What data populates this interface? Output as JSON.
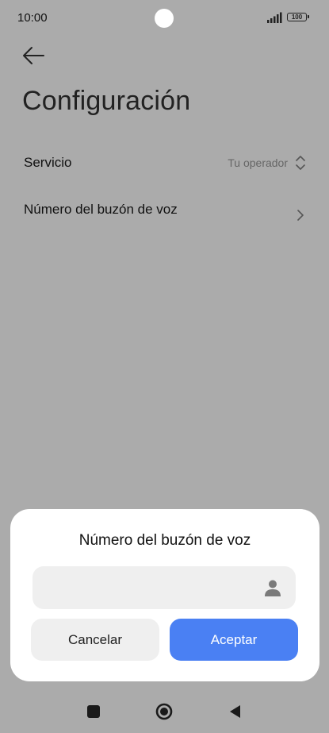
{
  "status_bar": {
    "time": "10:00",
    "battery": "100",
    "icons": [
      "signal-icon",
      "battery-icon"
    ]
  },
  "header": {
    "back_icon": "arrow-left-icon",
    "title": "Configuración"
  },
  "settings": {
    "service": {
      "label": "Servicio",
      "value": "Tu operador",
      "icon": "chevron-up-down-icon"
    },
    "voicemail_number": {
      "label": "Número del buzón de voz",
      "icon": "chevron-right-icon"
    }
  },
  "dialog": {
    "title": "Número del buzón de voz",
    "input_value": "",
    "input_icon": "contact-icon",
    "cancel_label": "Cancelar",
    "accept_label": "Aceptar"
  },
  "nav_bar": {
    "icons": [
      "recent-apps-icon",
      "home-icon",
      "back-icon"
    ]
  },
  "colors": {
    "accent": "#4a80f3",
    "scrim_background": "#ababab",
    "dialog_background": "#ffffff",
    "field_background": "#efefef"
  }
}
